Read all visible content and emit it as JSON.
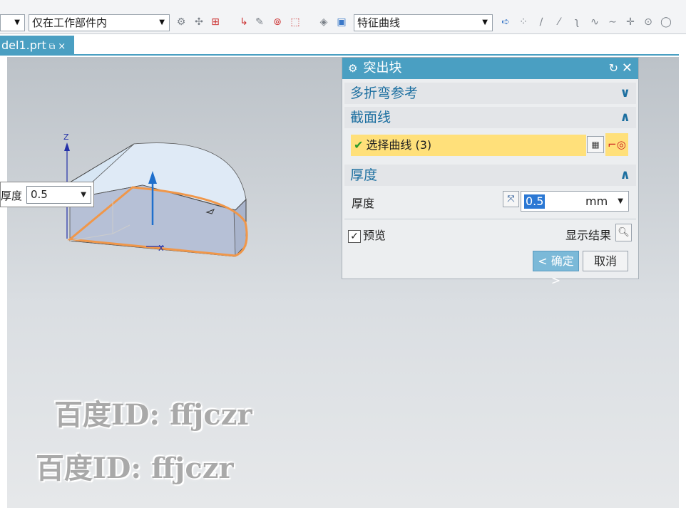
{
  "toolbar": {
    "filter_value": "仅在工作部件内",
    "curve_rule_value": "特征曲线",
    "icons": [
      "snap-icon",
      "point-icon",
      "select-icon",
      "arrow-icon",
      "cube-icon",
      "curve-icon",
      "line-icon",
      "circle-icon"
    ]
  },
  "tab": {
    "label": "del1.prt",
    "close": "×"
  },
  "floating": {
    "label": "厚度",
    "value": "0.5"
  },
  "dialog": {
    "title": "突出块",
    "groups": {
      "multi_bend": "多折弯参考",
      "section": "截面线",
      "thickness": "厚度"
    },
    "select_curve": "选择曲线 (3)",
    "thickness_label": "厚度",
    "thickness_value": "0.5",
    "thickness_unit": "mm",
    "preview_label": "预览",
    "show_result": "显示结果",
    "ok": "< 确定 >",
    "cancel": "取消"
  },
  "axis": {
    "z": "Z",
    "x": "X"
  },
  "watermark": "百度ID: ffjczr",
  "colors": {
    "accent": "#4a9fc2",
    "selection": "#ffe07a",
    "edge": "#f0974a"
  }
}
